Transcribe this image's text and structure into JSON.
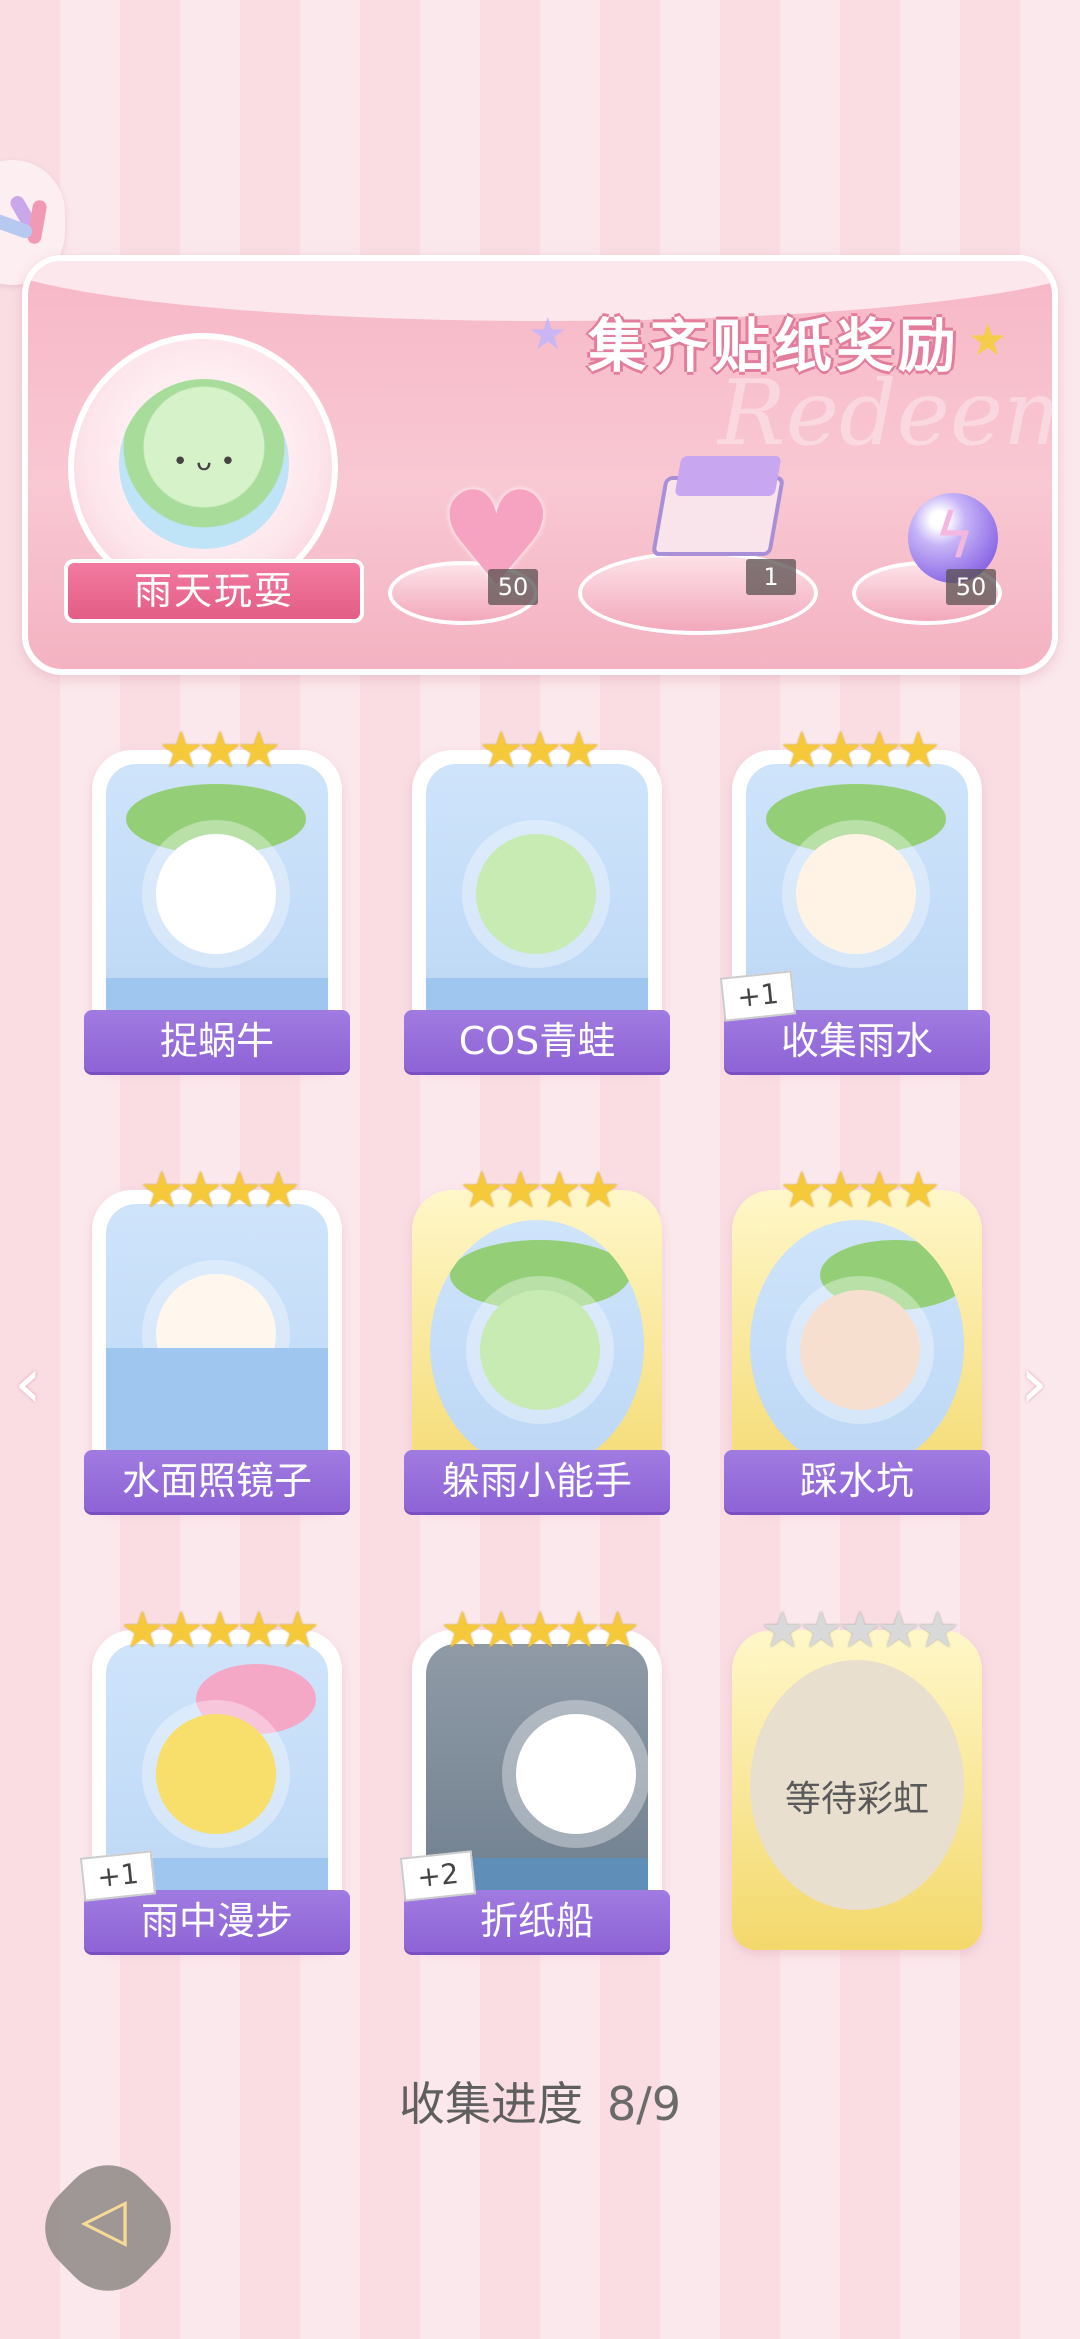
{
  "panel": {
    "title": "集齐贴纸奖励",
    "watermark": "Redeem",
    "theme_name": "雨天玩耍",
    "rewards": [
      {
        "icon": "heart-gem-icon",
        "count": "50"
      },
      {
        "icon": "gift-box-icon",
        "count": "1"
      },
      {
        "icon": "energy-orb-icon",
        "count": "50"
      }
    ]
  },
  "stickers": [
    {
      "name": "捉蜗牛",
      "stars": "★★★",
      "extra": ""
    },
    {
      "name": "COS青蛙",
      "stars": "★★★",
      "extra": ""
    },
    {
      "name": "收集雨水",
      "stars": "★★★★",
      "extra": "+1"
    },
    {
      "name": "水面照镜子",
      "stars": "★★★★",
      "extra": ""
    },
    {
      "name": "躲雨小能手",
      "stars": "★★★★",
      "extra": ""
    },
    {
      "name": "踩水坑",
      "stars": "★★★★",
      "extra": ""
    },
    {
      "name": "雨中漫步",
      "stars": "★★★★★",
      "extra": "+1"
    },
    {
      "name": "折纸船",
      "stars": "★★★★★",
      "extra": "+2"
    },
    {
      "name": "等待彩虹",
      "stars": "★★★★★",
      "extra": ""
    }
  ],
  "progress": {
    "label": "收集进度",
    "value": "8/9"
  },
  "colors": {
    "label_purple": "#9a70dc",
    "star_gold": "#f5c93a",
    "panel_pink": "#f7b7c6"
  }
}
